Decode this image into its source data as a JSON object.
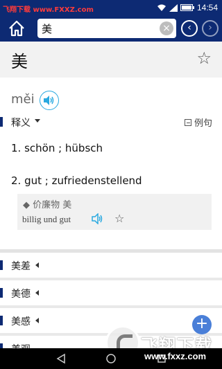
{
  "status_bar": {
    "watermark": "飞翔下载 www.FXXZ.com",
    "time": "14:54"
  },
  "search": {
    "value": "美",
    "placeholder": ""
  },
  "entry": {
    "headword": "美",
    "pinyin": "měi",
    "section_title": "释义",
    "example_toggle": "例句",
    "definitions": [
      "1. schön ; hübsch",
      "2. gut ; zufriedenstellend"
    ],
    "example": {
      "chinese": "◆ 价廉物 美",
      "german": "billig und gut"
    }
  },
  "related": [
    {
      "label": "美差"
    },
    {
      "label": "美德"
    },
    {
      "label": "美感"
    },
    {
      "label": "美观"
    }
  ],
  "watermark": {
    "brand": "飞翔下载",
    "url": "www.fxxz.com"
  },
  "colors": {
    "primary": "#0d2a73",
    "accent": "#29a9e0",
    "fab": "#4a7fd8"
  }
}
